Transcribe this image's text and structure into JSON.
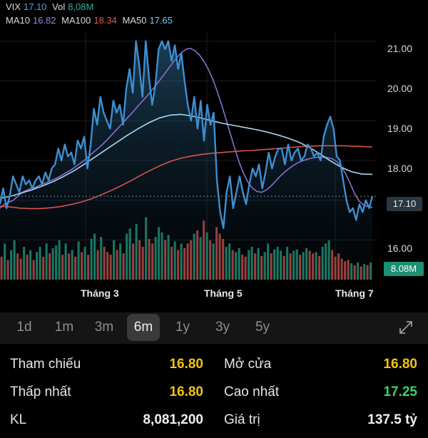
{
  "legend": {
    "symbol": "VIX",
    "price": "17.10",
    "vol_label": "Vol",
    "vol_value": "8,08M",
    "ma10_label": "MA10",
    "ma10_value": "16.82",
    "ma100_label": "MA100",
    "ma100_value": "18.34",
    "ma50_label": "MA50",
    "ma50_value": "17.65"
  },
  "colors": {
    "price_line": "#3d8fd1",
    "ma10": "#8a6fcf",
    "ma100": "#d9534f",
    "ma50": "#a8d8f0",
    "vol_up": "#1fa383",
    "vol_down": "#d8534f",
    "yellow": "#f1c40f",
    "green": "#3ed06a"
  },
  "chart_data": {
    "type": "line",
    "y_ticks": [
      "21.00",
      "20.00",
      "19.00",
      "18.00",
      "16.00"
    ],
    "ylim": [
      15.2,
      21.3
    ],
    "x_ticks": [
      "Tháng 3",
      "Tháng 5",
      "Tháng 7"
    ],
    "current_price_tag": "17.10",
    "current_volume_tag": "8.08M",
    "series": [
      {
        "name": "VIX",
        "values": [
          16.9,
          17.3,
          16.8,
          17.1,
          17.6,
          17.4,
          17.2,
          17.6,
          17.4,
          17.5,
          17.3,
          17.5,
          17.6,
          17.4,
          17.7,
          17.5,
          17.8,
          17.9,
          18.3,
          18.0,
          18.4,
          18.1,
          18.2,
          17.9,
          18.5,
          18.3,
          18.6,
          17.8,
          18.4,
          19.3,
          18.9,
          19.6,
          19.2,
          19.0,
          18.8,
          19.5,
          19.2,
          19.4,
          18.9,
          19.8,
          20.3,
          19.7,
          21.0,
          20.4,
          19.6,
          21.0,
          20.1,
          19.4,
          19.9,
          20.8,
          21.0,
          20.8,
          21.0,
          20.5,
          20.9,
          20.3,
          20.7,
          20.0,
          19.4,
          19.0,
          19.6,
          18.8,
          19.5,
          18.5,
          19.4,
          18.9,
          19.2,
          17.5,
          16.7,
          16.3,
          17.2,
          17.6,
          16.8,
          17.2,
          17.6,
          17.2,
          16.9,
          17.4,
          17.8,
          17.6,
          17.9,
          17.3,
          17.7,
          18.2,
          17.8,
          18.1,
          18.3,
          18.3,
          17.9,
          18.4,
          18.0,
          18.2,
          18.3,
          18.0,
          18.1,
          18.4,
          18.3,
          18.1,
          18.2,
          18.0,
          18.6,
          18.9,
          19.1,
          18.8,
          18.1,
          18.0,
          17.5,
          17.0,
          16.7,
          16.8,
          16.5,
          16.9,
          16.7,
          17.0,
          16.8,
          17.1
        ]
      },
      {
        "name": "MA10",
        "values": [
          16.8,
          16.9,
          16.95,
          17.0,
          17.1,
          17.2,
          17.25,
          17.3,
          17.32,
          17.38,
          17.42,
          17.47,
          17.52,
          17.57,
          17.63,
          17.7,
          17.76,
          17.84,
          17.92,
          18.0,
          18.1,
          18.2,
          18.29,
          18.39,
          18.5,
          18.62,
          18.74,
          18.86,
          18.98,
          19.1,
          19.22,
          19.35,
          19.48,
          19.6,
          19.73,
          19.87,
          20.01,
          20.16,
          20.31,
          20.46,
          20.6,
          20.72,
          20.8,
          20.82,
          20.76,
          20.65,
          20.49,
          20.29,
          20.04,
          19.74,
          19.4,
          19.03,
          18.66,
          18.28,
          17.94,
          17.66,
          17.44,
          17.3,
          17.22,
          17.2,
          17.25,
          17.34,
          17.46,
          17.58,
          17.69,
          17.78,
          17.86,
          17.93,
          17.98,
          18.02,
          18.05,
          18.07,
          18.08,
          18.08,
          18.07,
          18.04,
          17.97,
          17.85,
          17.66,
          17.42,
          17.17,
          16.98,
          16.88,
          16.84,
          16.82
        ]
      },
      {
        "name": "MA100",
        "values": [
          16.85,
          16.83,
          16.8,
          16.79,
          16.79,
          16.81,
          16.84,
          16.89,
          16.95,
          17.03,
          17.13,
          17.24,
          17.36,
          17.49,
          17.63,
          17.76,
          17.88,
          17.98,
          18.06,
          18.11,
          18.15,
          18.18,
          18.2,
          18.22,
          18.24,
          18.25,
          18.27,
          18.29,
          18.31,
          18.33,
          18.35,
          18.36,
          18.37,
          18.37,
          18.37,
          18.36,
          18.35,
          18.34
        ]
      },
      {
        "name": "MA50",
        "values": [
          17.05,
          17.1,
          17.18,
          17.26,
          17.36,
          17.47,
          17.6,
          17.75,
          17.92,
          18.1,
          18.28,
          18.46,
          18.64,
          18.8,
          18.95,
          19.07,
          19.14,
          19.16,
          19.12,
          19.06,
          18.99,
          18.93,
          18.88,
          18.83,
          18.78,
          18.72,
          18.65,
          18.57,
          18.47,
          18.34,
          18.18,
          18.0,
          17.84,
          17.72,
          17.66,
          17.65
        ]
      }
    ],
    "volume": [
      {
        "v": 0.35,
        "up": 0
      },
      {
        "v": 0.55,
        "up": 1
      },
      {
        "v": 0.3,
        "up": 0
      },
      {
        "v": 0.45,
        "up": 1
      },
      {
        "v": 0.6,
        "up": 1
      },
      {
        "v": 0.4,
        "up": 0
      },
      {
        "v": 0.32,
        "up": 0
      },
      {
        "v": 0.5,
        "up": 1
      },
      {
        "v": 0.38,
        "up": 0
      },
      {
        "v": 0.45,
        "up": 1
      },
      {
        "v": 0.3,
        "up": 0
      },
      {
        "v": 0.42,
        "up": 1
      },
      {
        "v": 0.5,
        "up": 1
      },
      {
        "v": 0.35,
        "up": 0
      },
      {
        "v": 0.55,
        "up": 1
      },
      {
        "v": 0.4,
        "up": 0
      },
      {
        "v": 0.48,
        "up": 1
      },
      {
        "v": 0.52,
        "up": 1
      },
      {
        "v": 0.6,
        "up": 1
      },
      {
        "v": 0.38,
        "up": 0
      },
      {
        "v": 0.55,
        "up": 1
      },
      {
        "v": 0.4,
        "up": 0
      },
      {
        "v": 0.45,
        "up": 1
      },
      {
        "v": 0.35,
        "up": 0
      },
      {
        "v": 0.58,
        "up": 1
      },
      {
        "v": 0.42,
        "up": 0
      },
      {
        "v": 0.5,
        "up": 1
      },
      {
        "v": 0.38,
        "up": 0
      },
      {
        "v": 0.62,
        "up": 1
      },
      {
        "v": 0.7,
        "up": 1
      },
      {
        "v": 0.45,
        "up": 0
      },
      {
        "v": 0.65,
        "up": 1
      },
      {
        "v": 0.5,
        "up": 0
      },
      {
        "v": 0.42,
        "up": 0
      },
      {
        "v": 0.38,
        "up": 0
      },
      {
        "v": 0.6,
        "up": 1
      },
      {
        "v": 0.45,
        "up": 0
      },
      {
        "v": 0.55,
        "up": 1
      },
      {
        "v": 0.4,
        "up": 0
      },
      {
        "v": 0.7,
        "up": 1
      },
      {
        "v": 0.78,
        "up": 1
      },
      {
        "v": 0.55,
        "up": 0
      },
      {
        "v": 0.85,
        "up": 1
      },
      {
        "v": 0.6,
        "up": 0
      },
      {
        "v": 0.5,
        "up": 0
      },
      {
        "v": 0.95,
        "up": 1
      },
      {
        "v": 0.62,
        "up": 0
      },
      {
        "v": 0.55,
        "up": 0
      },
      {
        "v": 0.65,
        "up": 1
      },
      {
        "v": 0.8,
        "up": 1
      },
      {
        "v": 0.72,
        "up": 1
      },
      {
        "v": 0.6,
        "up": 0
      },
      {
        "v": 0.68,
        "up": 1
      },
      {
        "v": 0.5,
        "up": 0
      },
      {
        "v": 0.58,
        "up": 1
      },
      {
        "v": 0.45,
        "up": 0
      },
      {
        "v": 0.55,
        "up": 1
      },
      {
        "v": 0.48,
        "up": 0
      },
      {
        "v": 0.55,
        "up": 0
      },
      {
        "v": 0.6,
        "up": 0
      },
      {
        "v": 0.7,
        "up": 1
      },
      {
        "v": 0.75,
        "up": 0
      },
      {
        "v": 0.65,
        "up": 1
      },
      {
        "v": 0.9,
        "up": 0
      },
      {
        "v": 0.72,
        "up": 1
      },
      {
        "v": 0.6,
        "up": 0
      },
      {
        "v": 0.55,
        "up": 1
      },
      {
        "v": 0.8,
        "up": 0
      },
      {
        "v": 0.7,
        "up": 0
      },
      {
        "v": 0.62,
        "up": 0
      },
      {
        "v": 0.5,
        "up": 1
      },
      {
        "v": 0.55,
        "up": 1
      },
      {
        "v": 0.45,
        "up": 0
      },
      {
        "v": 0.42,
        "up": 1
      },
      {
        "v": 0.48,
        "up": 1
      },
      {
        "v": 0.38,
        "up": 0
      },
      {
        "v": 0.35,
        "up": 0
      },
      {
        "v": 0.45,
        "up": 1
      },
      {
        "v": 0.5,
        "up": 1
      },
      {
        "v": 0.4,
        "up": 0
      },
      {
        "v": 0.48,
        "up": 1
      },
      {
        "v": 0.36,
        "up": 0
      },
      {
        "v": 0.42,
        "up": 1
      },
      {
        "v": 0.55,
        "up": 1
      },
      {
        "v": 0.4,
        "up": 0
      },
      {
        "v": 0.46,
        "up": 1
      },
      {
        "v": 0.5,
        "up": 1
      },
      {
        "v": 0.44,
        "up": 1
      },
      {
        "v": 0.36,
        "up": 0
      },
      {
        "v": 0.5,
        "up": 1
      },
      {
        "v": 0.4,
        "up": 0
      },
      {
        "v": 0.44,
        "up": 1
      },
      {
        "v": 0.46,
        "up": 1
      },
      {
        "v": 0.38,
        "up": 0
      },
      {
        "v": 0.42,
        "up": 1
      },
      {
        "v": 0.48,
        "up": 1
      },
      {
        "v": 0.44,
        "up": 0
      },
      {
        "v": 0.4,
        "up": 0
      },
      {
        "v": 0.42,
        "up": 1
      },
      {
        "v": 0.36,
        "up": 0
      },
      {
        "v": 0.5,
        "up": 1
      },
      {
        "v": 0.55,
        "up": 1
      },
      {
        "v": 0.6,
        "up": 1
      },
      {
        "v": 0.45,
        "up": 0
      },
      {
        "v": 0.35,
        "up": 0
      },
      {
        "v": 0.4,
        "up": 0
      },
      {
        "v": 0.32,
        "up": 0
      },
      {
        "v": 0.28,
        "up": 0
      },
      {
        "v": 0.3,
        "up": 0
      },
      {
        "v": 0.25,
        "up": 1
      },
      {
        "v": 0.22,
        "up": 0
      },
      {
        "v": 0.26,
        "up": 1
      },
      {
        "v": 0.2,
        "up": 0
      },
      {
        "v": 0.24,
        "up": 1
      },
      {
        "v": 0.22,
        "up": 0
      },
      {
        "v": 0.26,
        "up": 1
      }
    ]
  },
  "ranges": [
    "1d",
    "1m",
    "3m",
    "6m",
    "1y",
    "3y",
    "5y"
  ],
  "active_range": "6m",
  "stats": {
    "tham_chieu_label": "Tham chiếu",
    "tham_chieu_value": "16.80",
    "mo_cua_label": "Mở cửa",
    "mo_cua_value": "16.80",
    "thap_nhat_label": "Thấp nhất",
    "thap_nhat_value": "16.80",
    "cao_nhat_label": "Cao nhất",
    "cao_nhat_value": "17.25",
    "kl_label": "KL",
    "kl_value": "8,081,200",
    "gia_tri_label": "Giá trị",
    "gia_tri_value": "137.5 tỷ"
  }
}
